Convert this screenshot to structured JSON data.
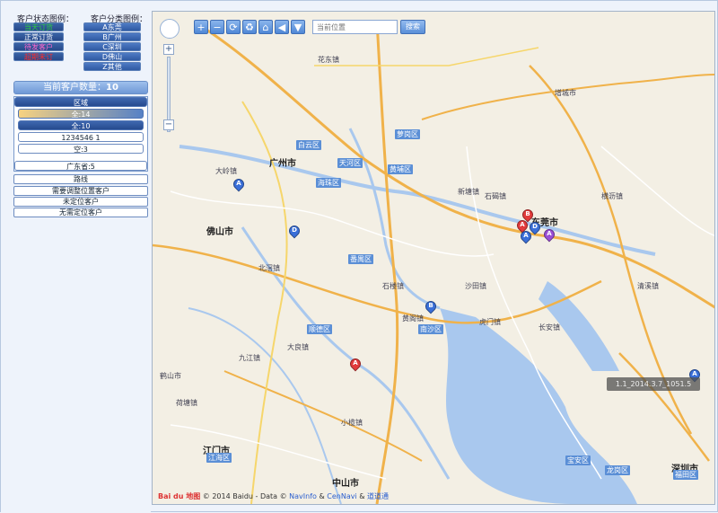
{
  "legend": {
    "status_title": "客户状态图例：",
    "category_title": "客户分类图例：",
    "status_items": [
      {
        "label": "当天订货",
        "color": "#2ecc40"
      },
      {
        "label": "正常订货",
        "color": "#ffffff"
      },
      {
        "label": "待发客户",
        "color": "#ff66cc"
      },
      {
        "label": "超期未订",
        "color": "#ff2a2a"
      }
    ],
    "category_items": [
      {
        "label": "A东莞"
      },
      {
        "label": "B广州"
      },
      {
        "label": "C深圳"
      },
      {
        "label": "D佛山"
      },
      {
        "label": "Z其他"
      }
    ]
  },
  "summary": {
    "label": "当前客户数量：",
    "count": "10"
  },
  "region": {
    "header": "区域",
    "items": [
      {
        "label": "全:14",
        "style": "gold"
      },
      {
        "label": "全:10",
        "style": "blue"
      },
      {
        "label": "1234546 1",
        "style": "white"
      },
      {
        "label": "空:3",
        "style": "white"
      }
    ],
    "footer": "广东省:5"
  },
  "lists": [
    {
      "label": "路线"
    },
    {
      "label": "需要调整位置客户"
    },
    {
      "label": "未定位客户"
    },
    {
      "label": "无需定位客户"
    }
  ],
  "map": {
    "search_placeholder": "当前位置",
    "search_button": "搜索",
    "toolbar_icons": [
      "plus-icon",
      "minus-icon",
      "refresh-icon",
      "recycle-icon",
      "home-icon",
      "arrow-down-icon",
      "filter-icon"
    ],
    "date_tip": "1.1_2014.3.7_1051.5",
    "copyright": {
      "logo": "Bai du 地图",
      "text": "© 2014 Baidu - Data ©",
      "link1": "NavInfo",
      "amp": "&",
      "link2": "CenNavi",
      "amp2": "&",
      "link3": "道道通"
    },
    "cities": [
      {
        "name": "广州市"
      },
      {
        "name": "佛山市"
      },
      {
        "name": "东莞市"
      },
      {
        "name": "江门市"
      },
      {
        "name": "中山市"
      },
      {
        "name": "深圳市"
      }
    ],
    "districts": [
      {
        "name": "白云区"
      },
      {
        "name": "天河区"
      },
      {
        "name": "海珠区"
      },
      {
        "name": "黄埔区"
      },
      {
        "name": "萝岗区"
      },
      {
        "name": "番禺区"
      },
      {
        "name": "南沙区"
      },
      {
        "name": "顺德区"
      },
      {
        "name": "江海区"
      },
      {
        "name": "宝安区"
      },
      {
        "name": "龙岗区"
      },
      {
        "name": "福田区"
      }
    ],
    "towns": [
      {
        "name": "大岭镇"
      },
      {
        "name": "花东镇"
      },
      {
        "name": "新塘镇"
      },
      {
        "name": "增城市"
      },
      {
        "name": "沙田镇"
      },
      {
        "name": "虎门镇"
      },
      {
        "name": "长安镇"
      },
      {
        "name": "石碣镇"
      },
      {
        "name": "北滘镇"
      },
      {
        "name": "大良镇"
      },
      {
        "name": "黄阁镇"
      },
      {
        "name": "小榄镇"
      },
      {
        "name": "荷塘镇"
      },
      {
        "name": "鹤山市"
      },
      {
        "name": "九江镇"
      },
      {
        "name": "石楼镇"
      },
      {
        "name": "横沥镇"
      },
      {
        "name": "清溪镇"
      }
    ],
    "markers": [
      {
        "letter": "A",
        "color": "#3a6fd8"
      },
      {
        "letter": "D",
        "color": "#3a6fd8"
      },
      {
        "letter": "B",
        "color": "#e23b3b"
      },
      {
        "letter": "A",
        "color": "#e23b3b"
      },
      {
        "letter": "A",
        "color": "#9b4fd6"
      },
      {
        "letter": "A",
        "color": "#3a6fd8"
      },
      {
        "letter": "B",
        "color": "#3a6fd8"
      },
      {
        "letter": "D",
        "color": "#3a6fd8"
      },
      {
        "letter": "A",
        "color": "#e23b3b"
      },
      {
        "letter": "A",
        "color": "#3a6fd8"
      }
    ]
  }
}
